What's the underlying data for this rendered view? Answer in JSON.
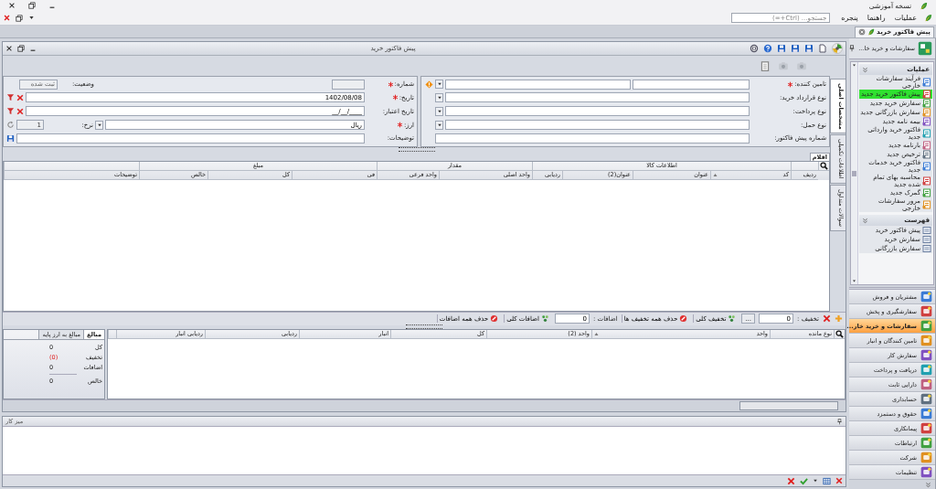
{
  "app_title": "نسخه آموزشی",
  "menu": [
    "عملیات",
    "راهنما",
    "پنجره"
  ],
  "search": {
    "placeholder": "جستجو... (Ctrl+=)"
  },
  "doc_tabs": [
    {
      "label": "پیش فاکتور خرید",
      "selected": true
    }
  ],
  "window": {
    "title": "پیش فاکتور خرید"
  },
  "side_tabs": [
    {
      "label": "مشخصات اصلی",
      "selected": true
    },
    {
      "label": "اطلاعات تکمیلی",
      "selected": false
    },
    {
      "label": "سوالات متداول",
      "selected": false
    }
  ],
  "supplier_form": [
    {
      "label": "تامین کننده:",
      "required": true,
      "kind": "double"
    },
    {
      "label": "نوع قرارداد خرید:",
      "required": false,
      "kind": "combo"
    },
    {
      "label": "نوع پرداخت:",
      "required": false,
      "kind": "combo"
    },
    {
      "label": "نوع حمل:",
      "required": false,
      "kind": "combo"
    },
    {
      "label": "شماره پیش فاکتور:",
      "required": false,
      "kind": "text"
    }
  ],
  "doc_form": {
    "number": {
      "label": "شماره:",
      "required": true
    },
    "status": {
      "label": "وضعیت:",
      "value": "ثبت شده"
    },
    "date": {
      "label": "تاریخ:",
      "required": true,
      "value": "1402/08/08"
    },
    "valid_date": {
      "label": "تاریخ اعتبار:",
      "required": false,
      "value": "__/__/____"
    },
    "currency": {
      "label": "ارز:",
      "required": true,
      "value": "ریال"
    },
    "rate": {
      "label": "نرخ:",
      "value": "1"
    },
    "notes": {
      "label": "توضیحات:",
      "required": false
    }
  },
  "items_tab": {
    "label": "اقلام",
    "selected": true
  },
  "items_table": {
    "header": [
      {
        "kind": "column",
        "label": "ردیف",
        "sorted": false
      },
      {
        "kind": "group",
        "label": "اطلاعات کالا",
        "columns": [
          {
            "label": "کد",
            "sorted": true
          },
          {
            "label": "عنوان",
            "sorted": false
          },
          {
            "label": "عنوان(2)",
            "sorted": false
          },
          {
            "label": "ردیابی",
            "sorted": false
          }
        ]
      },
      {
        "kind": "group",
        "label": "مقدار",
        "columns": [
          {
            "label": "واحد اصلی",
            "sorted": false
          },
          {
            "label": "واحد فرعی",
            "sorted": false
          }
        ]
      },
      {
        "kind": "group",
        "label": "مبلغ",
        "columns": [
          {
            "label": "فی",
            "sorted": false
          },
          {
            "label": "کل",
            "sorted": false
          },
          {
            "label": "خالص",
            "sorted": false
          }
        ]
      },
      {
        "kind": "column",
        "label": "توضیحات",
        "sorted": false
      }
    ]
  },
  "discount_bar": {
    "discount_label": "تخفیف :",
    "discount_value": "0",
    "more_button": "...",
    "total_discount": "تخفیف کلی",
    "remove_discounts": "حذف همه تخفیف ها",
    "additions_label": "اضافات :",
    "additions_value": "0",
    "total_additions": "اضافات کلی",
    "remove_additions": "حذف همه اضافات"
  },
  "stock_table": {
    "columns": [
      {
        "label": "نوع مانده",
        "sorted": false
      },
      {
        "label": "واحد",
        "sorted": true
      },
      {
        "label": "واحد (2)",
        "sorted": false
      },
      {
        "label": "کل",
        "sorted": false
      },
      {
        "label": "انبار",
        "sorted": false
      },
      {
        "label": "ردیابی",
        "sorted": false
      },
      {
        "label": "ردیابی انبار",
        "sorted": false
      }
    ]
  },
  "summary": {
    "tabs": [
      {
        "label": "مبالغ",
        "selected": true
      },
      {
        "label": "مبالغ به ارز پایه",
        "selected": false
      }
    ],
    "rows": [
      {
        "label": "کل",
        "value": "0",
        "kind": "plain"
      },
      {
        "label": "تخفیف",
        "value": "(0)",
        "kind": "negative"
      },
      {
        "label": "اضافات",
        "value": "0",
        "kind": "plain"
      },
      {
        "label": "خالص",
        "value": "0",
        "kind": "total"
      }
    ]
  },
  "workspace": {
    "title": "میز کار"
  },
  "sidebar": {
    "title": "سفارشات و خرید خا...",
    "groups": [
      {
        "title": "عملیات",
        "items": [
          {
            "label": "فرآیند سفارشات خارجی",
            "selected": false
          },
          {
            "label": "پیش فاکتور خرید جدید",
            "selected": true
          },
          {
            "label": "سفارش خرید جدید",
            "selected": false
          },
          {
            "label": "سفارش بازرگانی جدید",
            "selected": false
          },
          {
            "label": "بیمه نامه جدید",
            "selected": false
          },
          {
            "label": "فاکتور خرید وارداتی جدید",
            "selected": false
          },
          {
            "label": "بارنامه جدید",
            "selected": false
          },
          {
            "label": "ترخیص جدید",
            "selected": false
          },
          {
            "label": "فاکتور خرید خدمات جدید",
            "selected": false
          },
          {
            "label": "محاسبه بهای تمام شده جدید",
            "selected": false
          },
          {
            "label": "گمرک جدید",
            "selected": false
          },
          {
            "label": "مرور سفارشات خارجی",
            "selected": false
          }
        ]
      },
      {
        "title": "فهرست",
        "items": [
          {
            "label": "پیش فاکتور خرید",
            "selected": false
          },
          {
            "label": "سفارش خرید",
            "selected": false
          },
          {
            "label": "سفارش بازرگانی",
            "selected": false
          }
        ]
      }
    ],
    "nav": [
      {
        "label": "مشتریان و فروش",
        "selected": false
      },
      {
        "label": "سفارشگیری و پخش",
        "selected": false
      },
      {
        "label": "سفارشات و خرید خار...",
        "selected": true
      },
      {
        "label": "تامین کنندگان و انبار",
        "selected": false
      },
      {
        "label": "سفارش کار",
        "selected": false
      },
      {
        "label": "دریافت و پرداخت",
        "selected": false
      },
      {
        "label": "دارایی ثابت",
        "selected": false
      },
      {
        "label": "حسابداری",
        "selected": false
      },
      {
        "label": "حقوق و دستمزد",
        "selected": false
      },
      {
        "label": "پیمانکاری",
        "selected": false
      },
      {
        "label": "ارتباطات",
        "selected": false
      },
      {
        "label": "شرکت",
        "selected": false
      },
      {
        "label": "تنظیمات",
        "selected": false
      }
    ]
  }
}
